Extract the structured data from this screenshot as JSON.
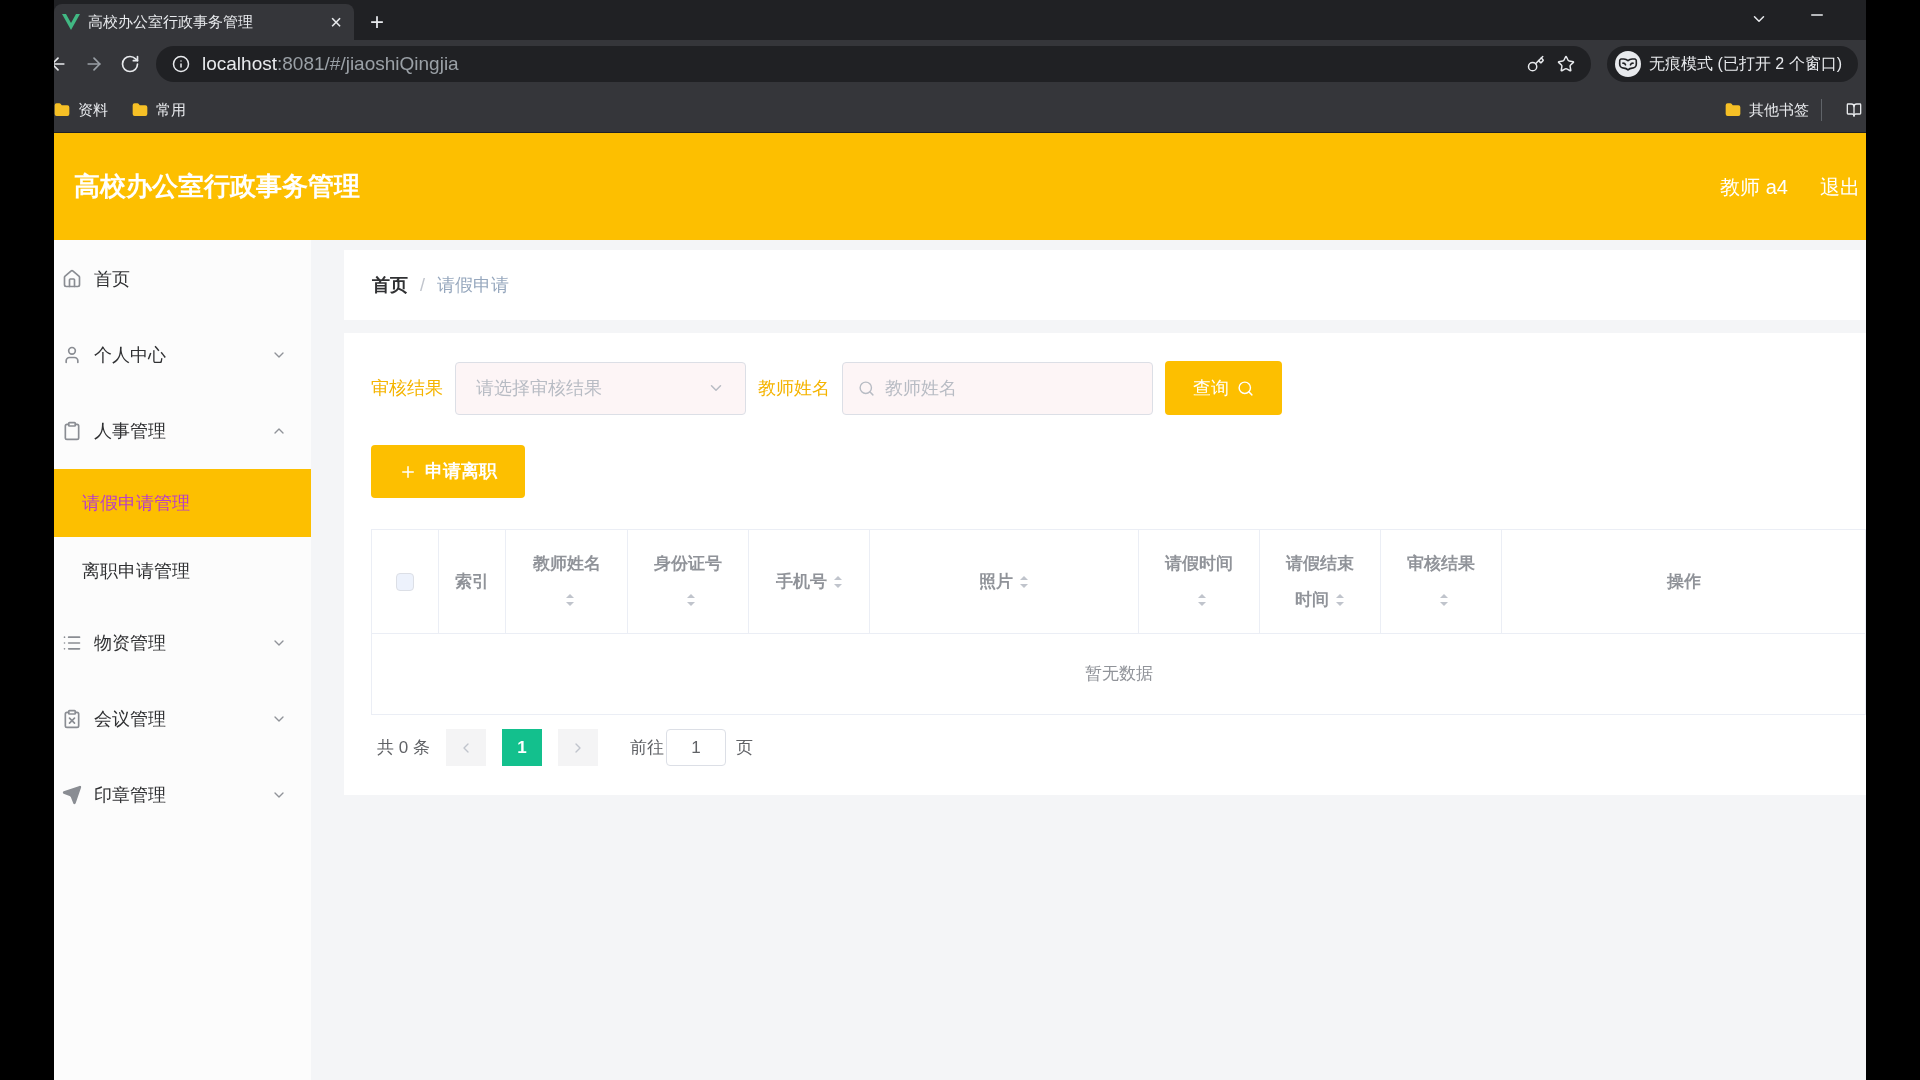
{
  "browser": {
    "tab": {
      "title": "高校办公室行政事务管理",
      "close": "×",
      "new_tab": "+"
    },
    "address": {
      "host": "localhost",
      "path": ":8081/#/jiaoshiQingjia"
    },
    "profile": "无痕模式 (已打开 2 个窗口)",
    "bookmarks": [
      "资料",
      "常用"
    ],
    "other_bookmarks": "其他书签"
  },
  "header": {
    "title": "高校办公室行政事务管理",
    "user": "教师 a4",
    "logout": "退出"
  },
  "sidebar": {
    "items": [
      {
        "label": "首页",
        "kind": "home"
      },
      {
        "label": "个人中心",
        "kind": "user",
        "expanded": false
      },
      {
        "label": "人事管理",
        "kind": "clipboard",
        "expanded": true,
        "children": [
          {
            "label": "请假申请管理",
            "selected": true
          },
          {
            "label": "离职申请管理",
            "selected": false
          }
        ]
      },
      {
        "label": "物资管理",
        "kind": "list",
        "expanded": false
      },
      {
        "label": "会议管理",
        "kind": "clipboard-x",
        "expanded": false
      },
      {
        "label": "印章管理",
        "kind": "send",
        "expanded": false
      }
    ]
  },
  "breadcrumb": {
    "items": [
      "首页",
      "请假申请"
    ],
    "separator": "/"
  },
  "filters": [
    {
      "label": "审核结果",
      "kind": "select",
      "placeholder": "请选择审核结果"
    },
    {
      "label": "教师姓名",
      "kind": "search",
      "placeholder": "教师姓名"
    }
  ],
  "search_button": "查询",
  "add_button": "申请离职",
  "table": {
    "select_all_checked": false,
    "columns": [
      {
        "label": "索引",
        "sortable": false
      },
      {
        "label": "教师姓名",
        "sortable": true
      },
      {
        "label": "身份证号",
        "sortable": true
      },
      {
        "label": "手机号",
        "sortable": true
      },
      {
        "label": "照片",
        "sortable": true
      },
      {
        "label": "请假时间",
        "sortable": true
      },
      {
        "label": "请假结束时间",
        "sortable": true
      },
      {
        "label": "审核结果",
        "sortable": true
      },
      {
        "label": "操作",
        "sortable": false
      }
    ],
    "empty_text": "暂无数据"
  },
  "pagination": {
    "total": "共 0 条",
    "pages": [
      {
        "label": "1",
        "selected": true
      }
    ],
    "goto_prefix": "前往",
    "goto_value": "1",
    "goto_suffix": "页"
  }
}
